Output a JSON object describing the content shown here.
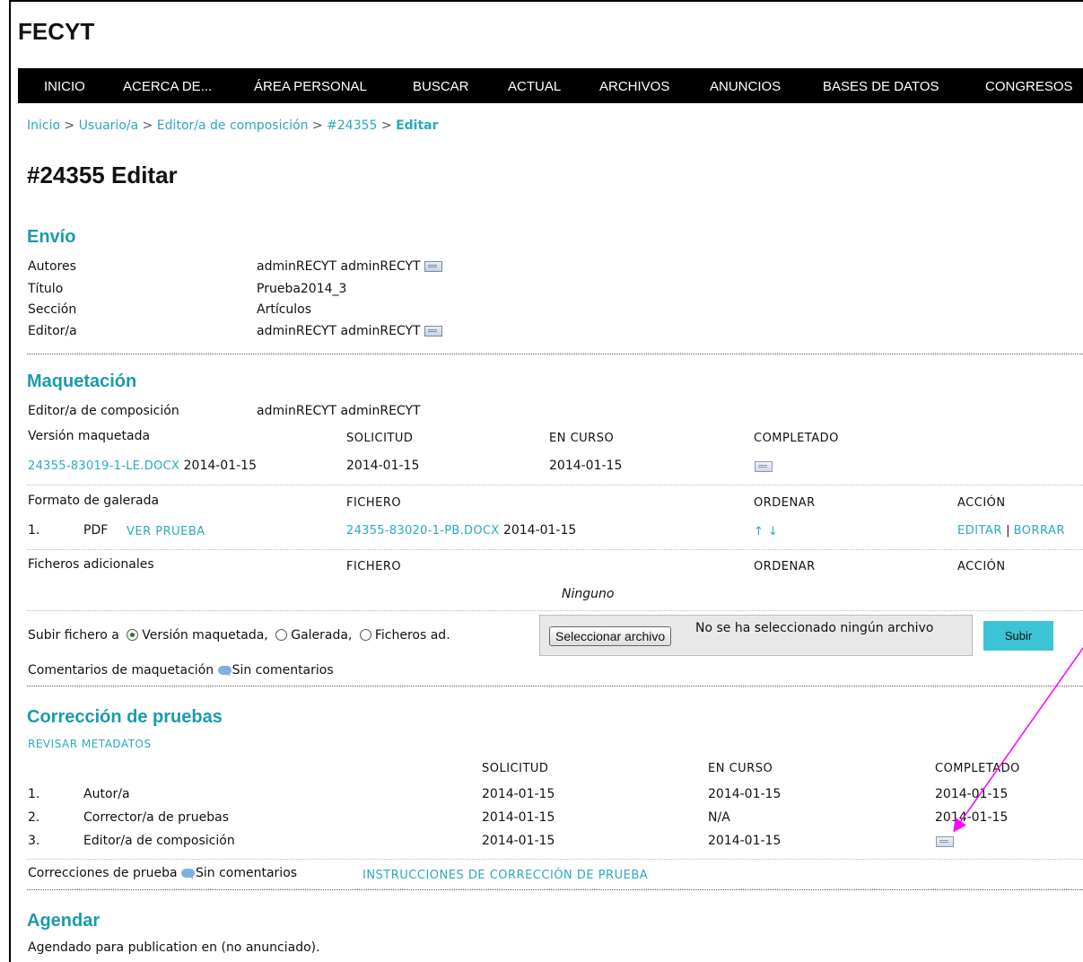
{
  "site": {
    "title": "FECYT"
  },
  "nav": [
    "INICIO",
    "ACERCA DE...",
    "ÁREA PERSONAL",
    "BUSCAR",
    "ACTUAL",
    "ARCHIVOS",
    "ANUNCIOS",
    "BASES DE DATOS",
    "CONGRESOS"
  ],
  "breadcrumb": {
    "items": [
      "Inicio",
      "Usuario/a",
      "Editor/a de composición",
      "#24355"
    ],
    "current": "Editar",
    "sep": ">"
  },
  "page_title": "#24355 Editar",
  "envio": {
    "heading": "Envío",
    "autores_label": "Autores",
    "autores_value": "adminRECYT adminRECYT",
    "titulo_label": "Título",
    "titulo_value": "Prueba2014_3",
    "seccion_label": "Sección",
    "seccion_value": "Artículos",
    "editor_label": "Editor/a",
    "editor_value": "adminRECYT adminRECYT"
  },
  "maquetacion": {
    "heading": "Maquetación",
    "editor_comp_label": "Editor/a de composición",
    "editor_comp_value": "adminRECYT adminRECYT",
    "version_label": "Versión maquetada",
    "col_solicitud": "SOLICITUD",
    "col_en_curso": "EN CURSO",
    "col_completado": "COMPLETADO",
    "version_file": "24355-83019-1-LE.DOCX",
    "version_file_date": "2014-01-15",
    "version_solicitud": "2014-01-15",
    "version_en_curso": "2014-01-15",
    "galerada_label": "Formato de galerada",
    "col_fichero": "FICHERO",
    "col_ordenar": "ORDENAR",
    "col_accion": "ACCIÓN",
    "galerada_num": "1.",
    "galerada_format": "PDF",
    "galerada_view": "VER PRUEBA",
    "galerada_file": "24355-83020-1-PB.DOCX",
    "galerada_file_date": "2014-01-15",
    "galerada_order": "↑ ↓",
    "galerada_edit": "EDITAR",
    "galerada_action_sep": "|",
    "galerada_delete": "BORRAR",
    "adicionales_label": "Ficheros adicionales",
    "adicionales_none": "Ninguno",
    "upload_label": "Subir fichero a",
    "radio_version": "Versión maquetada,",
    "radio_galerada": "Galerada,",
    "radio_ficheros": "Ficheros ad.",
    "file_button": "Seleccionar archivo",
    "file_status": "No se ha seleccionado ningún archivo",
    "upload_button": "Subir",
    "comments_label": "Comentarios de maquetación",
    "comments_value": "Sin comentarios"
  },
  "correccion": {
    "heading": "Corrección de pruebas",
    "review_link": "REVISAR METADATOS",
    "col_solicitud": "SOLICITUD",
    "col_en_curso": "EN CURSO",
    "col_completado": "COMPLETADO",
    "rows": [
      {
        "num": "1.",
        "role": "Autor/a",
        "solicitud": "2014-01-15",
        "en_curso": "2014-01-15",
        "completado": "2014-01-15"
      },
      {
        "num": "2.",
        "role": "Corrector/a de pruebas",
        "solicitud": "2014-01-15",
        "en_curso": "N/A",
        "completado": "2014-01-15"
      },
      {
        "num": "3.",
        "role": "Editor/a de composición",
        "solicitud": "2014-01-15",
        "en_curso": "2014-01-15",
        "completado": ""
      }
    ],
    "comments_label": "Correcciones de prueba",
    "comments_value": "Sin comentarios",
    "instructions_link": "INSTRUCCIONES DE CORRECCIÓN DE PRUEBA"
  },
  "agendar": {
    "heading": "Agendar",
    "text": "Agendado para publication en (no anunciado)."
  },
  "annotation": {
    "color": "#ff00ff"
  },
  "colors": {
    "accent": "#2aa9bd",
    "heading": "#1b9aae",
    "nav_bg": "#000000",
    "upload_btn": "#3cc3d6"
  }
}
